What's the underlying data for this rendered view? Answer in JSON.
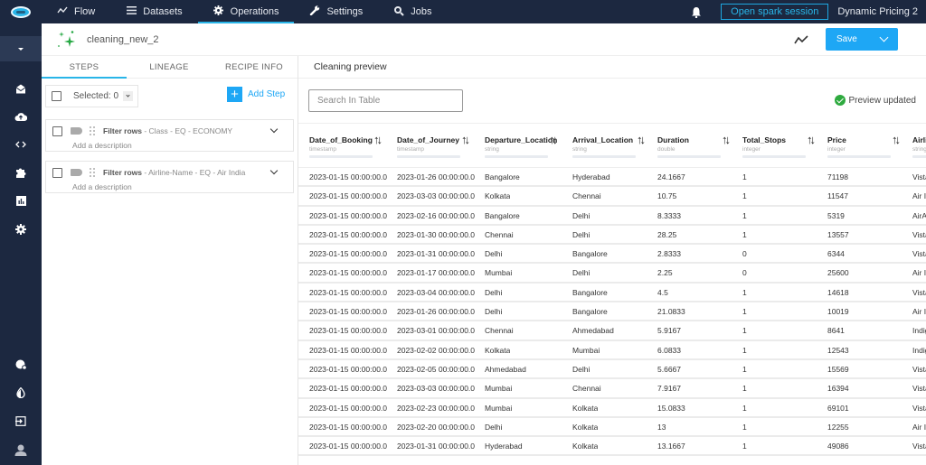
{
  "topbar": {
    "nav": [
      {
        "label": "Flow",
        "icon": "flow-icon",
        "glyph": "〰",
        "active": false
      },
      {
        "label": "Datasets",
        "icon": "list-icon",
        "glyph": "☰",
        "active": false
      },
      {
        "label": "Operations",
        "icon": "gear-icon",
        "glyph": "⚙",
        "active": true
      },
      {
        "label": "Settings",
        "icon": "wrench-icon",
        "glyph": "🔧",
        "active": false
      },
      {
        "label": "Jobs",
        "icon": "jobs-search-icon",
        "glyph": "🔍",
        "active": false
      }
    ],
    "spark_button": "Open spark session",
    "project_name": "Dynamic Pricing 2"
  },
  "rail": {
    "items": [
      {
        "name": "collapse-toggle",
        "icon": "caret-down-icon"
      },
      {
        "name": "inbox",
        "icon": "inbox-icon",
        "glyph": "✉"
      },
      {
        "name": "upload",
        "icon": "cloud-upload-icon",
        "glyph": "☁"
      },
      {
        "name": "code",
        "icon": "code-icon",
        "glyph": "‹›"
      },
      {
        "name": "extensions",
        "icon": "puzzle-icon",
        "glyph": "✚"
      },
      {
        "name": "reports",
        "icon": "bar-chart-icon",
        "glyph": "▥"
      },
      {
        "name": "settings",
        "icon": "gear-icon",
        "glyph": "⚙"
      }
    ],
    "bottom_items": [
      {
        "name": "admin",
        "icon": "shield-gear-icon",
        "glyph": "⬢"
      },
      {
        "name": "theme",
        "icon": "contrast-icon",
        "glyph": "◐"
      },
      {
        "name": "logout",
        "icon": "sign-out-icon",
        "glyph": "⇥"
      },
      {
        "name": "profile",
        "icon": "user-icon",
        "glyph": "👤"
      }
    ]
  },
  "recipe": {
    "title": "cleaning_new_2",
    "save_label": "Save"
  },
  "left_panel": {
    "tabs": [
      {
        "label": "STEPS",
        "active": true
      },
      {
        "label": "LINEAGE",
        "active": false
      },
      {
        "label": "RECIPE INFO",
        "active": false
      }
    ],
    "selected_label": "Selected: 0",
    "add_step_label": "Add Step",
    "steps": [
      {
        "action": "Filter rows",
        "detail": " - Class - EQ - ECONOMY",
        "description": "Add a description"
      },
      {
        "action": "Filter rows",
        "detail": " - Airline-Name - EQ - Air India",
        "description": "Add a description"
      }
    ]
  },
  "preview": {
    "title": "Cleaning preview",
    "search_placeholder": "Search In Table",
    "status": "Preview updated",
    "columns": [
      {
        "name": "Date_of_Booking",
        "type": "timestamp"
      },
      {
        "name": "Date_of_Journey",
        "type": "timestamp"
      },
      {
        "name": "Departure_Location",
        "type": "string"
      },
      {
        "name": "Arrival_Location",
        "type": "string"
      },
      {
        "name": "Duration",
        "type": "double"
      },
      {
        "name": "Total_Stops",
        "type": "integer"
      },
      {
        "name": "Price",
        "type": "integer"
      },
      {
        "name": "Airli",
        "type": "string"
      }
    ],
    "rows": [
      [
        "2023-01-15 00:00:00.0",
        "2023-01-26 00:00:00.0",
        "Bangalore",
        "Hyderabad",
        "24.1667",
        "1",
        "71198",
        "Vista"
      ],
      [
        "2023-01-15 00:00:00.0",
        "2023-03-03 00:00:00.0",
        "Kolkata",
        "Chennai",
        "10.75",
        "1",
        "11547",
        "Air In"
      ],
      [
        "2023-01-15 00:00:00.0",
        "2023-02-16 00:00:00.0",
        "Bangalore",
        "Delhi",
        "8.3333",
        "1",
        "5319",
        "AirAs"
      ],
      [
        "2023-01-15 00:00:00.0",
        "2023-01-30 00:00:00.0",
        "Chennai",
        "Delhi",
        "28.25",
        "1",
        "13557",
        "Vista"
      ],
      [
        "2023-01-15 00:00:00.0",
        "2023-01-31 00:00:00.0",
        "Delhi",
        "Bangalore",
        "2.8333",
        "0",
        "6344",
        "Vista"
      ],
      [
        "2023-01-15 00:00:00.0",
        "2023-01-17 00:00:00.0",
        "Mumbai",
        "Delhi",
        "2.25",
        "0",
        "25600",
        "Air In"
      ],
      [
        "2023-01-15 00:00:00.0",
        "2023-03-04 00:00:00.0",
        "Delhi",
        "Bangalore",
        "4.5",
        "1",
        "14618",
        "Vista"
      ],
      [
        "2023-01-15 00:00:00.0",
        "2023-01-26 00:00:00.0",
        "Delhi",
        "Bangalore",
        "21.0833",
        "1",
        "10019",
        "Air In"
      ],
      [
        "2023-01-15 00:00:00.0",
        "2023-03-01 00:00:00.0",
        "Chennai",
        "Ahmedabad",
        "5.9167",
        "1",
        "8641",
        "Indig"
      ],
      [
        "2023-01-15 00:00:00.0",
        "2023-02-02 00:00:00.0",
        "Kolkata",
        "Mumbai",
        "6.0833",
        "1",
        "12543",
        "Indig"
      ],
      [
        "2023-01-15 00:00:00.0",
        "2023-02-05 00:00:00.0",
        "Ahmedabad",
        "Delhi",
        "5.6667",
        "1",
        "15569",
        "Vista"
      ],
      [
        "2023-01-15 00:00:00.0",
        "2023-03-03 00:00:00.0",
        "Mumbai",
        "Chennai",
        "7.9167",
        "1",
        "16394",
        "Vista"
      ],
      [
        "2023-01-15 00:00:00.0",
        "2023-02-23 00:00:00.0",
        "Mumbai",
        "Kolkata",
        "15.0833",
        "1",
        "69101",
        "Vista"
      ],
      [
        "2023-01-15 00:00:00.0",
        "2023-02-20 00:00:00.0",
        "Delhi",
        "Kolkata",
        "13",
        "1",
        "12255",
        "Air In"
      ],
      [
        "2023-01-15 00:00:00.0",
        "2023-01-31 00:00:00.0",
        "Hyderabad",
        "Kolkata",
        "13.1667",
        "1",
        "49086",
        "Vista"
      ]
    ]
  },
  "colors": {
    "topbar_bg": "#1c2840",
    "accent": "#1ea7f5",
    "status_ok": "#2eaa3f"
  }
}
